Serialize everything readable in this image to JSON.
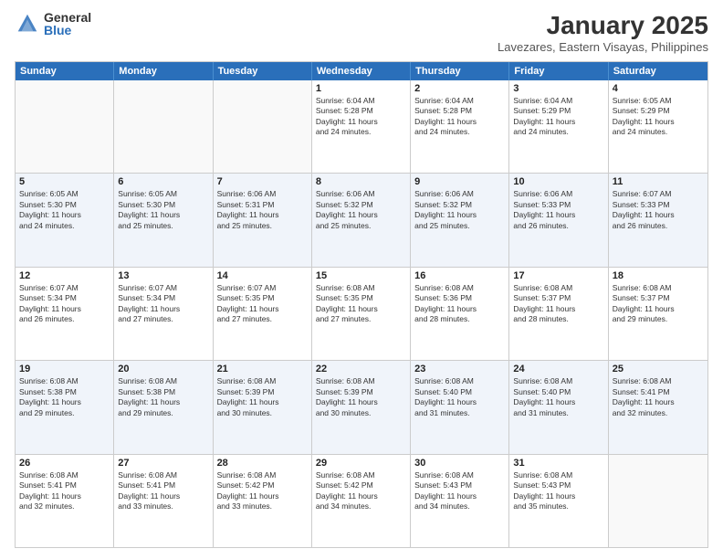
{
  "logo": {
    "general": "General",
    "blue": "Blue"
  },
  "title": "January 2025",
  "location": "Lavezares, Eastern Visayas, Philippines",
  "days": [
    "Sunday",
    "Monday",
    "Tuesday",
    "Wednesday",
    "Thursday",
    "Friday",
    "Saturday"
  ],
  "rows": [
    [
      {
        "day": "",
        "lines": []
      },
      {
        "day": "",
        "lines": []
      },
      {
        "day": "",
        "lines": []
      },
      {
        "day": "1",
        "lines": [
          "Sunrise: 6:04 AM",
          "Sunset: 5:28 PM",
          "Daylight: 11 hours",
          "and 24 minutes."
        ]
      },
      {
        "day": "2",
        "lines": [
          "Sunrise: 6:04 AM",
          "Sunset: 5:28 PM",
          "Daylight: 11 hours",
          "and 24 minutes."
        ]
      },
      {
        "day": "3",
        "lines": [
          "Sunrise: 6:04 AM",
          "Sunset: 5:29 PM",
          "Daylight: 11 hours",
          "and 24 minutes."
        ]
      },
      {
        "day": "4",
        "lines": [
          "Sunrise: 6:05 AM",
          "Sunset: 5:29 PM",
          "Daylight: 11 hours",
          "and 24 minutes."
        ]
      }
    ],
    [
      {
        "day": "5",
        "lines": [
          "Sunrise: 6:05 AM",
          "Sunset: 5:30 PM",
          "Daylight: 11 hours",
          "and 24 minutes."
        ]
      },
      {
        "day": "6",
        "lines": [
          "Sunrise: 6:05 AM",
          "Sunset: 5:30 PM",
          "Daylight: 11 hours",
          "and 25 minutes."
        ]
      },
      {
        "day": "7",
        "lines": [
          "Sunrise: 6:06 AM",
          "Sunset: 5:31 PM",
          "Daylight: 11 hours",
          "and 25 minutes."
        ]
      },
      {
        "day": "8",
        "lines": [
          "Sunrise: 6:06 AM",
          "Sunset: 5:32 PM",
          "Daylight: 11 hours",
          "and 25 minutes."
        ]
      },
      {
        "day": "9",
        "lines": [
          "Sunrise: 6:06 AM",
          "Sunset: 5:32 PM",
          "Daylight: 11 hours",
          "and 25 minutes."
        ]
      },
      {
        "day": "10",
        "lines": [
          "Sunrise: 6:06 AM",
          "Sunset: 5:33 PM",
          "Daylight: 11 hours",
          "and 26 minutes."
        ]
      },
      {
        "day": "11",
        "lines": [
          "Sunrise: 6:07 AM",
          "Sunset: 5:33 PM",
          "Daylight: 11 hours",
          "and 26 minutes."
        ]
      }
    ],
    [
      {
        "day": "12",
        "lines": [
          "Sunrise: 6:07 AM",
          "Sunset: 5:34 PM",
          "Daylight: 11 hours",
          "and 26 minutes."
        ]
      },
      {
        "day": "13",
        "lines": [
          "Sunrise: 6:07 AM",
          "Sunset: 5:34 PM",
          "Daylight: 11 hours",
          "and 27 minutes."
        ]
      },
      {
        "day": "14",
        "lines": [
          "Sunrise: 6:07 AM",
          "Sunset: 5:35 PM",
          "Daylight: 11 hours",
          "and 27 minutes."
        ]
      },
      {
        "day": "15",
        "lines": [
          "Sunrise: 6:08 AM",
          "Sunset: 5:35 PM",
          "Daylight: 11 hours",
          "and 27 minutes."
        ]
      },
      {
        "day": "16",
        "lines": [
          "Sunrise: 6:08 AM",
          "Sunset: 5:36 PM",
          "Daylight: 11 hours",
          "and 28 minutes."
        ]
      },
      {
        "day": "17",
        "lines": [
          "Sunrise: 6:08 AM",
          "Sunset: 5:37 PM",
          "Daylight: 11 hours",
          "and 28 minutes."
        ]
      },
      {
        "day": "18",
        "lines": [
          "Sunrise: 6:08 AM",
          "Sunset: 5:37 PM",
          "Daylight: 11 hours",
          "and 29 minutes."
        ]
      }
    ],
    [
      {
        "day": "19",
        "lines": [
          "Sunrise: 6:08 AM",
          "Sunset: 5:38 PM",
          "Daylight: 11 hours",
          "and 29 minutes."
        ]
      },
      {
        "day": "20",
        "lines": [
          "Sunrise: 6:08 AM",
          "Sunset: 5:38 PM",
          "Daylight: 11 hours",
          "and 29 minutes."
        ]
      },
      {
        "day": "21",
        "lines": [
          "Sunrise: 6:08 AM",
          "Sunset: 5:39 PM",
          "Daylight: 11 hours",
          "and 30 minutes."
        ]
      },
      {
        "day": "22",
        "lines": [
          "Sunrise: 6:08 AM",
          "Sunset: 5:39 PM",
          "Daylight: 11 hours",
          "and 30 minutes."
        ]
      },
      {
        "day": "23",
        "lines": [
          "Sunrise: 6:08 AM",
          "Sunset: 5:40 PM",
          "Daylight: 11 hours",
          "and 31 minutes."
        ]
      },
      {
        "day": "24",
        "lines": [
          "Sunrise: 6:08 AM",
          "Sunset: 5:40 PM",
          "Daylight: 11 hours",
          "and 31 minutes."
        ]
      },
      {
        "day": "25",
        "lines": [
          "Sunrise: 6:08 AM",
          "Sunset: 5:41 PM",
          "Daylight: 11 hours",
          "and 32 minutes."
        ]
      }
    ],
    [
      {
        "day": "26",
        "lines": [
          "Sunrise: 6:08 AM",
          "Sunset: 5:41 PM",
          "Daylight: 11 hours",
          "and 32 minutes."
        ]
      },
      {
        "day": "27",
        "lines": [
          "Sunrise: 6:08 AM",
          "Sunset: 5:41 PM",
          "Daylight: 11 hours",
          "and 33 minutes."
        ]
      },
      {
        "day": "28",
        "lines": [
          "Sunrise: 6:08 AM",
          "Sunset: 5:42 PM",
          "Daylight: 11 hours",
          "and 33 minutes."
        ]
      },
      {
        "day": "29",
        "lines": [
          "Sunrise: 6:08 AM",
          "Sunset: 5:42 PM",
          "Daylight: 11 hours",
          "and 34 minutes."
        ]
      },
      {
        "day": "30",
        "lines": [
          "Sunrise: 6:08 AM",
          "Sunset: 5:43 PM",
          "Daylight: 11 hours",
          "and 34 minutes."
        ]
      },
      {
        "day": "31",
        "lines": [
          "Sunrise: 6:08 AM",
          "Sunset: 5:43 PM",
          "Daylight: 11 hours",
          "and 35 minutes."
        ]
      },
      {
        "day": "",
        "lines": []
      }
    ]
  ]
}
